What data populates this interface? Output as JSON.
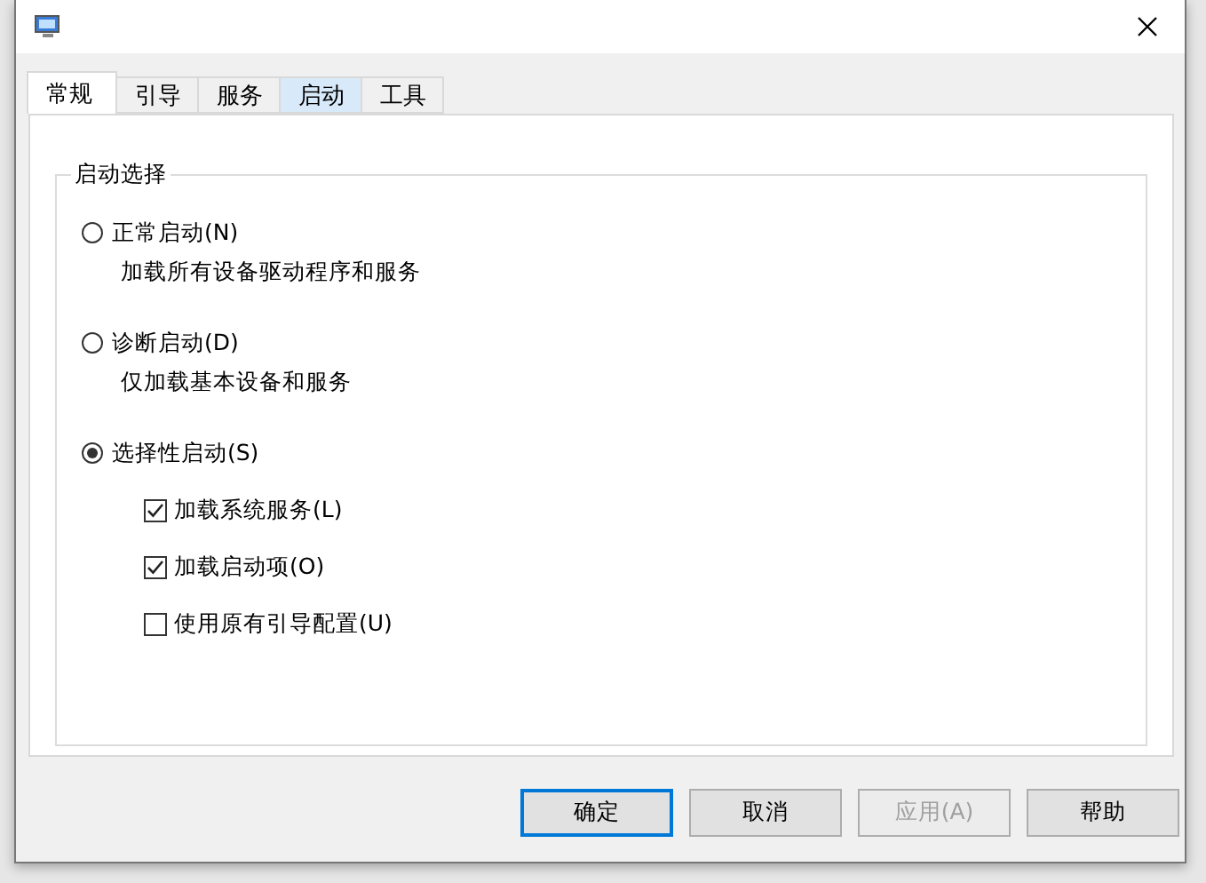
{
  "tabs": [
    {
      "label": "常规",
      "selected": true,
      "hover": false
    },
    {
      "label": "引导",
      "selected": false,
      "hover": false
    },
    {
      "label": "服务",
      "selected": false,
      "hover": false
    },
    {
      "label": "启动",
      "selected": false,
      "hover": true
    },
    {
      "label": "工具",
      "selected": false,
      "hover": false
    }
  ],
  "group": {
    "title": "启动选择",
    "options": [
      {
        "label": "正常启动(N)",
        "selected": false,
        "description": "加载所有设备驱动程序和服务"
      },
      {
        "label": "诊断启动(D)",
        "selected": false,
        "description": "仅加载基本设备和服务"
      },
      {
        "label": "选择性启动(S)",
        "selected": true,
        "checkboxes": [
          {
            "label": "加载系统服务(L)",
            "checked": true
          },
          {
            "label": "加载启动项(O)",
            "checked": true
          },
          {
            "label": "使用原有引导配置(U)",
            "checked": false
          }
        ]
      }
    ]
  },
  "buttons": [
    {
      "label": "确定",
      "default": true,
      "disabled": false
    },
    {
      "label": "取消",
      "default": false,
      "disabled": false
    },
    {
      "label": "应用(A)",
      "default": false,
      "disabled": true
    },
    {
      "label": "帮助",
      "default": false,
      "disabled": false
    }
  ]
}
